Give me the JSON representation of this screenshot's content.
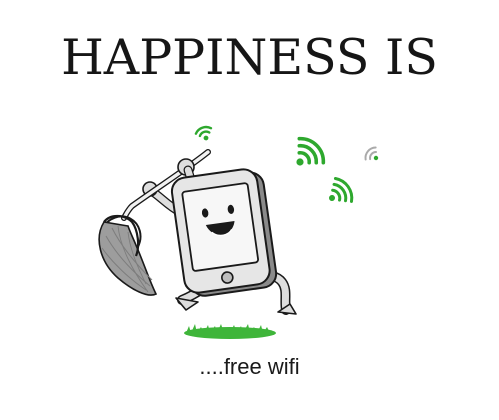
{
  "headline": "HAPPINESS IS",
  "caption": "....free wifi",
  "illustration": {
    "icons": [
      "wifi-signal-icon",
      "smartphone-character",
      "butterfly-net",
      "grass-patch"
    ],
    "colors": {
      "ink": "#1a1a1a",
      "phone_body": "#e4e4e4",
      "phone_shadow": "#8a8a8a",
      "screen": "#f7f7f7",
      "wifi_green": "#2ea82e",
      "grass_green": "#3fb53a",
      "net_gray": "#9a9a9a"
    }
  }
}
